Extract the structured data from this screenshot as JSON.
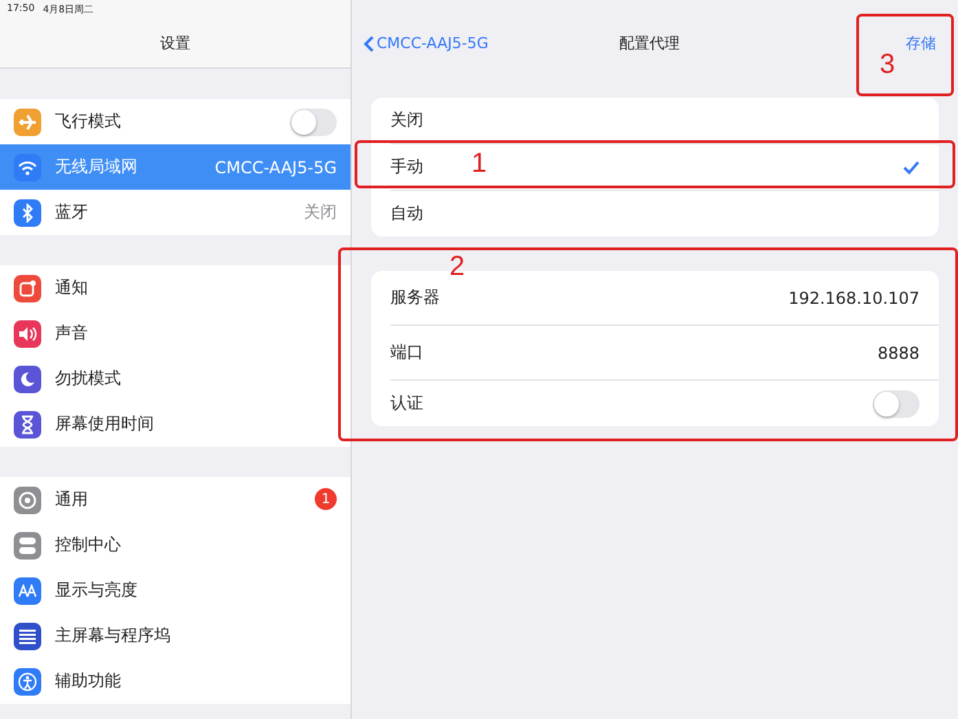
{
  "status_bar": {
    "time": "17:50",
    "date": "4月8日周二"
  },
  "sidebar": {
    "title": "设置",
    "groups": [
      [
        {
          "kind": "toggle",
          "label": "飞行模式",
          "on": false,
          "selected": false,
          "color": "#f0a030"
        },
        {
          "kind": "value",
          "label": "无线局域网",
          "value": "CMCC-AAJ5-5G",
          "selected": true,
          "color": "#2f7cf6"
        },
        {
          "kind": "value",
          "label": "蓝牙",
          "value": "关闭",
          "selected": false,
          "color": "#2f7cf6"
        }
      ],
      [
        {
          "kind": "plain",
          "label": "通知",
          "selected": false,
          "color": "#ee4a3c"
        },
        {
          "kind": "plain",
          "label": "声音",
          "selected": false,
          "color": "#e8375a"
        },
        {
          "kind": "plain",
          "label": "勿扰模式",
          "selected": false,
          "color": "#5a55d6"
        },
        {
          "kind": "plain",
          "label": "屏幕使用时间",
          "selected": false,
          "color": "#5a55d6"
        }
      ],
      [
        {
          "kind": "badge",
          "label": "通用",
          "badge": "1",
          "selected": false,
          "color": "#8e8e93"
        },
        {
          "kind": "plain",
          "label": "控制中心",
          "selected": false,
          "color": "#8e8e93"
        },
        {
          "kind": "plain",
          "label": "显示与亮度",
          "selected": false,
          "color": "#2f7cf6"
        },
        {
          "kind": "plain",
          "label": "主屏幕与程序坞",
          "selected": false,
          "color": "#2f50c8"
        },
        {
          "kind": "plain",
          "label": "辅助功能",
          "selected": false,
          "color": "#2f7cf6"
        }
      ]
    ]
  },
  "detail": {
    "back": "CMCC-AAJ5-5G",
    "title": "配置代理",
    "action": "存储",
    "modes": [
      {
        "label": "关闭",
        "selected": false
      },
      {
        "label": "手动",
        "selected": true
      },
      {
        "label": "自动",
        "selected": false
      }
    ],
    "fields": [
      {
        "label": "服务器",
        "value": "192.168.10.107"
      },
      {
        "label": "端口",
        "value": "8888"
      }
    ],
    "auth": {
      "label": "认证",
      "on": false
    }
  },
  "annotations": [
    {
      "label": "1"
    },
    {
      "label": "2"
    },
    {
      "label": "3"
    }
  ]
}
